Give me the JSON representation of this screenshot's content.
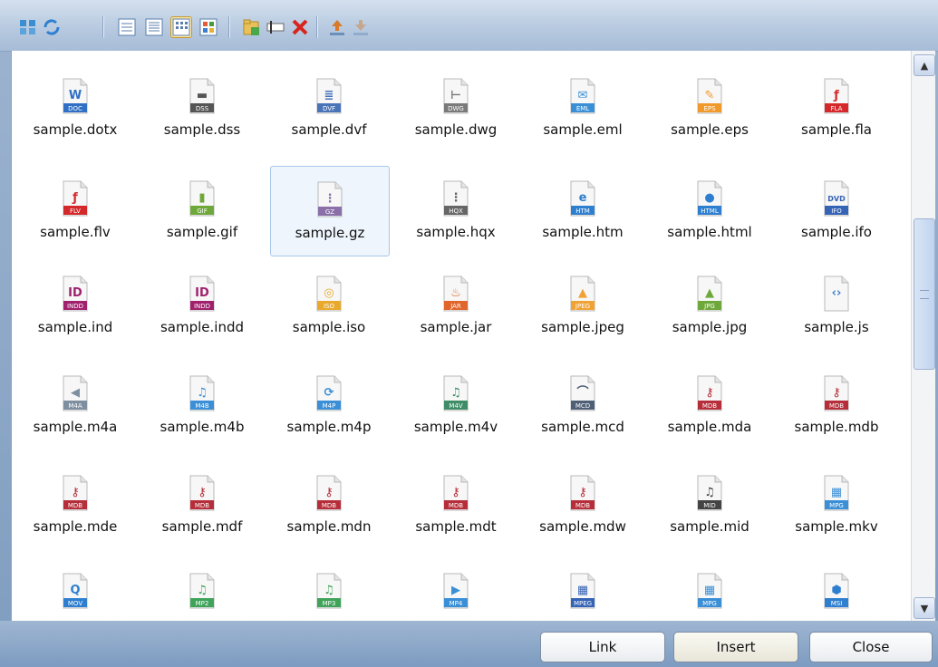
{
  "toolbar": {
    "icons": [
      "thumbnails-icon",
      "refresh-icon",
      "details-view-icon",
      "list-view-icon",
      "small-icons-view-icon",
      "large-icons-view-icon",
      "new-folder-icon",
      "rename-icon",
      "delete-icon",
      "upload-icon",
      "download-icon"
    ],
    "active_view": "small-icons-view-icon"
  },
  "files": [
    {
      "name": "sample.dotx",
      "badge": "DOC",
      "color": "#2f6fc5",
      "glyph": "W"
    },
    {
      "name": "sample.dss",
      "badge": "DSS",
      "color": "#555555",
      "glyph": "▬"
    },
    {
      "name": "sample.dvf",
      "badge": "DVF",
      "color": "#4a74b8",
      "glyph": "≣"
    },
    {
      "name": "sample.dwg",
      "badge": "DWG",
      "color": "#7a7a7a",
      "glyph": "⊢"
    },
    {
      "name": "sample.eml",
      "badge": "EML",
      "color": "#3a8fd6",
      "glyph": "✉"
    },
    {
      "name": "sample.eps",
      "badge": "EPS",
      "color": "#f09a2c",
      "glyph": "✎"
    },
    {
      "name": "sample.fla",
      "badge": "FLA",
      "color": "#d5282b",
      "glyph": "ƒ"
    },
    {
      "name": "sample.flv",
      "badge": "FLV",
      "color": "#d5282b",
      "glyph": "ƒ"
    },
    {
      "name": "sample.gif",
      "badge": "GIF",
      "color": "#6ea83a",
      "glyph": "▮"
    },
    {
      "name": "sample.gz",
      "badge": "GZ",
      "color": "#8a6fa8",
      "glyph": "⋮"
    },
    {
      "name": "sample.hqx",
      "badge": "HQX",
      "color": "#666666",
      "glyph": "⋮"
    },
    {
      "name": "sample.htm",
      "badge": "HTM",
      "color": "#2f7fd0",
      "glyph": "e"
    },
    {
      "name": "sample.html",
      "badge": "HTML",
      "color": "#2f7fd0",
      "glyph": "●"
    },
    {
      "name": "sample.ifo",
      "badge": "IFO",
      "color": "#3563b5",
      "glyph": "DVD"
    },
    {
      "name": "sample.ind",
      "badge": "INDD",
      "color": "#a0216c",
      "glyph": "ID"
    },
    {
      "name": "sample.indd",
      "badge": "INDD",
      "color": "#a0216c",
      "glyph": "ID"
    },
    {
      "name": "sample.iso",
      "badge": "ISO",
      "color": "#e8a92c",
      "glyph": "◎"
    },
    {
      "name": "sample.jar",
      "badge": "JAR",
      "color": "#e0662b",
      "glyph": "♨"
    },
    {
      "name": "sample.jpeg",
      "badge": "JPEG",
      "color": "#f0a234",
      "glyph": "▲"
    },
    {
      "name": "sample.jpg",
      "badge": "JPG",
      "color": "#6ea83a",
      "glyph": "▲"
    },
    {
      "name": "sample.js",
      "badge": "",
      "color": "#3a7fd0",
      "glyph": "‹›"
    },
    {
      "name": "sample.m4a",
      "badge": "M4A",
      "color": "#7e8f9f",
      "glyph": "◀"
    },
    {
      "name": "sample.m4b",
      "badge": "M4B",
      "color": "#3a8fd6",
      "glyph": "♫"
    },
    {
      "name": "sample.m4p",
      "badge": "M4P",
      "color": "#3a8fd6",
      "glyph": "⟳"
    },
    {
      "name": "sample.m4v",
      "badge": "M4V",
      "color": "#3e8d66",
      "glyph": "♫"
    },
    {
      "name": "sample.mcd",
      "badge": "MCD",
      "color": "#4f6076",
      "glyph": "⌒"
    },
    {
      "name": "sample.mda",
      "badge": "MDB",
      "color": "#b62e3a",
      "glyph": "⚷"
    },
    {
      "name": "sample.mdb",
      "badge": "MDB",
      "color": "#b62e3a",
      "glyph": "⚷"
    },
    {
      "name": "sample.mde",
      "badge": "MDB",
      "color": "#b62e3a",
      "glyph": "⚷"
    },
    {
      "name": "sample.mdf",
      "badge": "MDB",
      "color": "#b62e3a",
      "glyph": "⚷"
    },
    {
      "name": "sample.mdn",
      "badge": "MDB",
      "color": "#b62e3a",
      "glyph": "⚷"
    },
    {
      "name": "sample.mdt",
      "badge": "MDB",
      "color": "#b62e3a",
      "glyph": "⚷"
    },
    {
      "name": "sample.mdw",
      "badge": "MDB",
      "color": "#b62e3a",
      "glyph": "⚷"
    },
    {
      "name": "sample.mid",
      "badge": "MID",
      "color": "#444444",
      "glyph": "♫"
    },
    {
      "name": "sample.mkv",
      "badge": "MPG",
      "color": "#3a8fd6",
      "glyph": "▦"
    },
    {
      "name": "",
      "badge": "MOV",
      "color": "#2f7fd0",
      "glyph": "Q"
    },
    {
      "name": "",
      "badge": "MP2",
      "color": "#3fa35a",
      "glyph": "♫"
    },
    {
      "name": "",
      "badge": "MP3",
      "color": "#3fa35a",
      "glyph": "♫"
    },
    {
      "name": "",
      "badge": "MP4",
      "color": "#3a8fd6",
      "glyph": "▶"
    },
    {
      "name": "",
      "badge": "MPEG",
      "color": "#3563b5",
      "glyph": "▦"
    },
    {
      "name": "",
      "badge": "MPG",
      "color": "#3a8fd6",
      "glyph": "▦"
    },
    {
      "name": "",
      "badge": "MSI",
      "color": "#2f7fd0",
      "glyph": "⬢"
    }
  ],
  "selected_file": "sample.gz",
  "buttons": {
    "link": "Link",
    "insert": "Insert",
    "close": "Close"
  }
}
